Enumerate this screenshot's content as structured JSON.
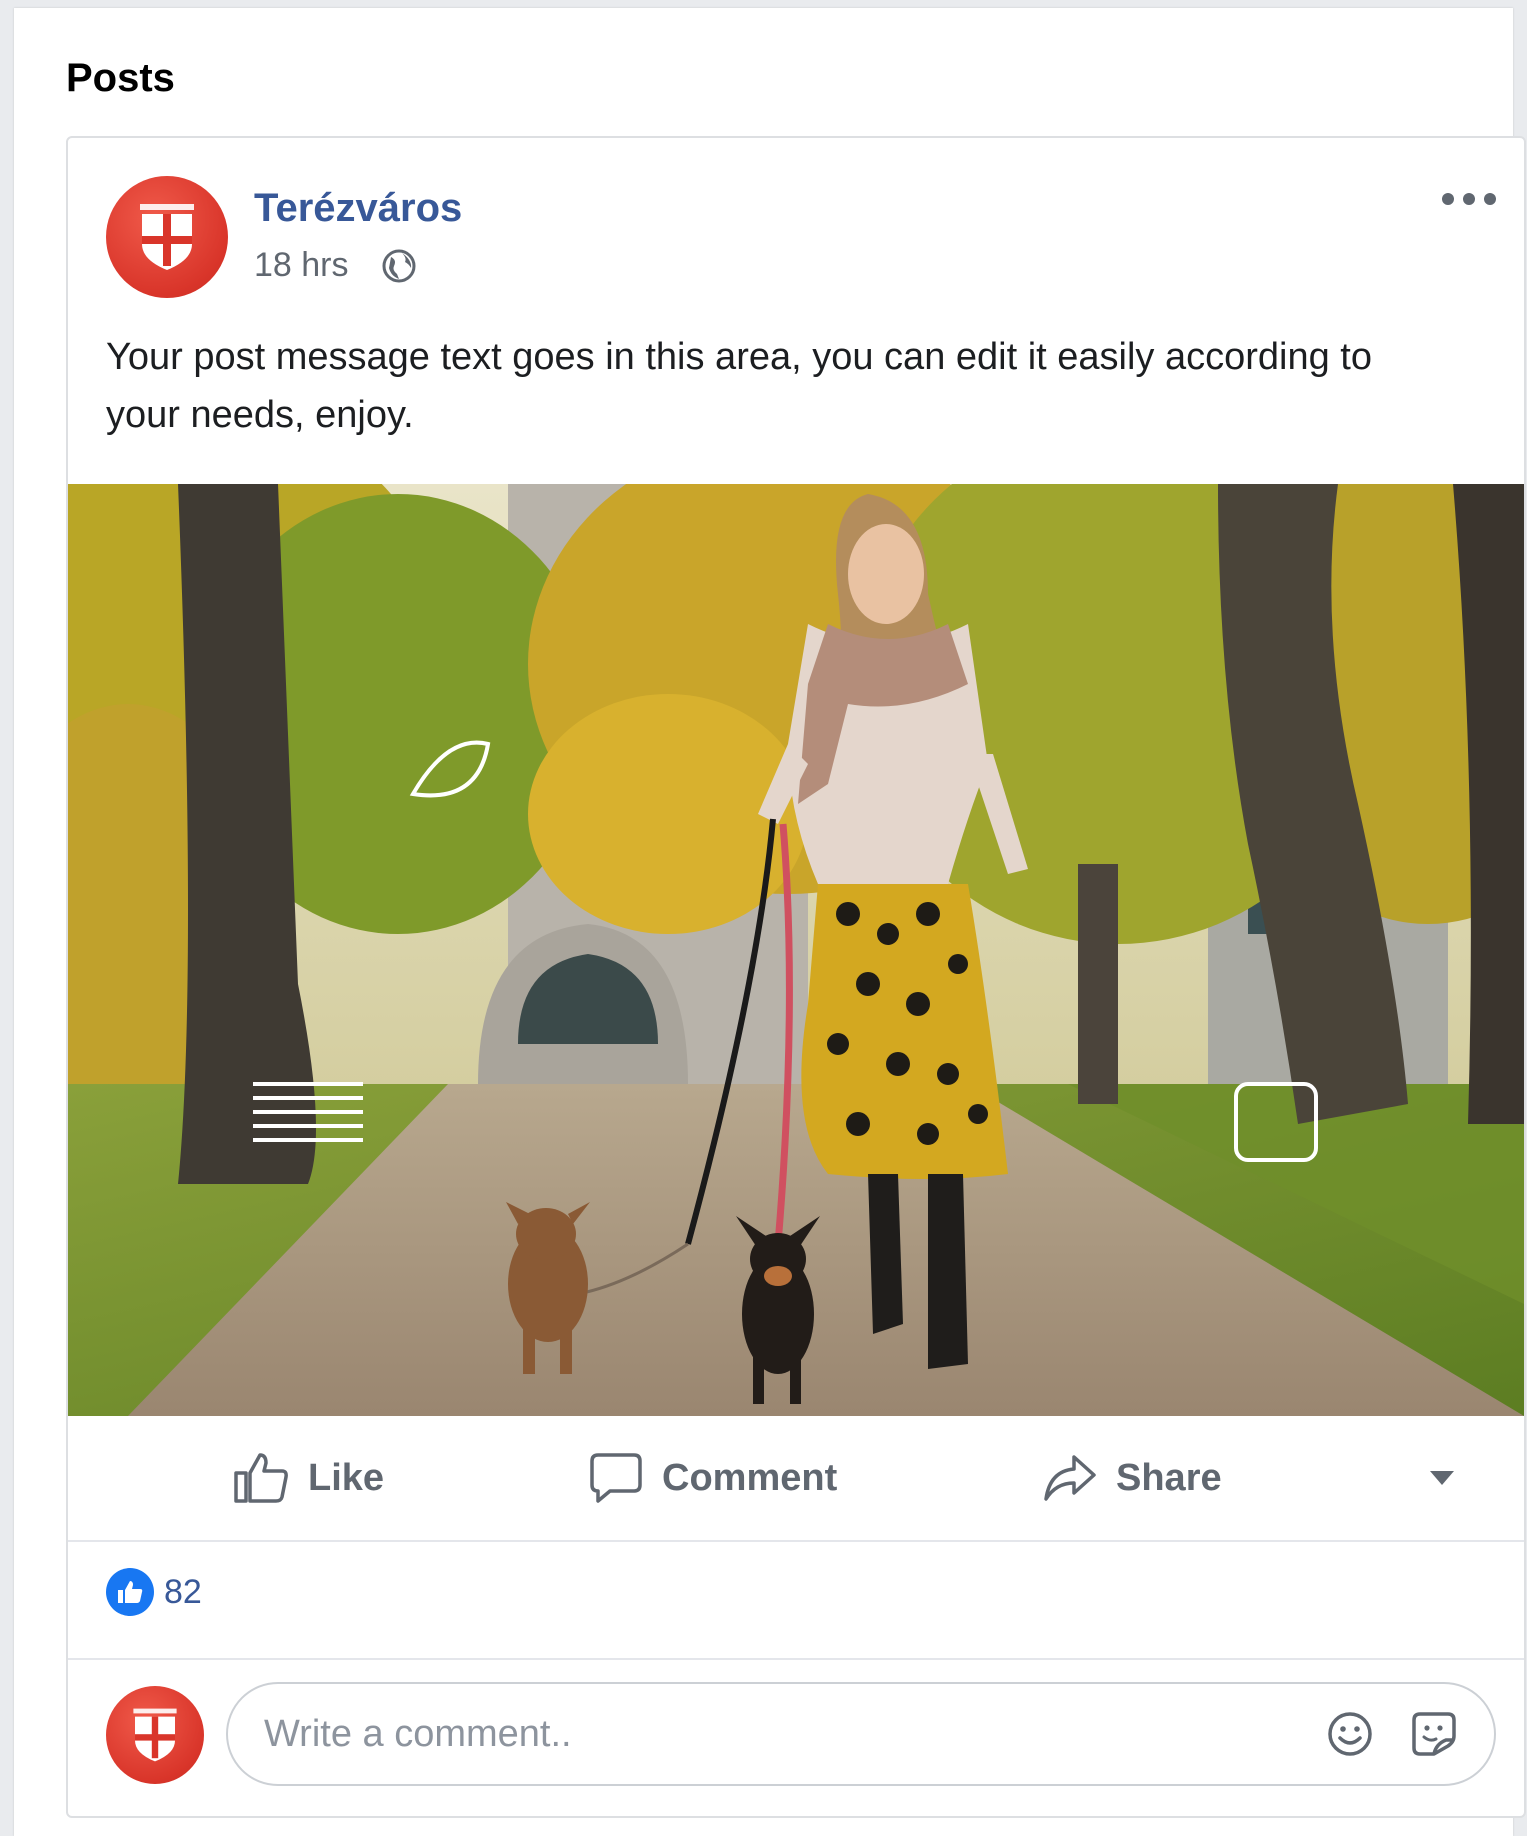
{
  "section": {
    "title": "Posts"
  },
  "post": {
    "author": "Terézváros",
    "time": "18 hrs",
    "privacy_icon": "globe-icon",
    "message": "Your post message text goes in this area, you can edit it easily according to your needs, enjoy.",
    "more_icon": "more-options-icon"
  },
  "actions": {
    "like": "Like",
    "comment": "Comment",
    "share": "Share"
  },
  "reactions": {
    "count": "82",
    "icon": "like-reaction-icon"
  },
  "comment": {
    "placeholder": "Write a comment.."
  },
  "colors": {
    "brand_red": "#d9352a",
    "link_blue": "#385898",
    "reaction_blue": "#1877f2",
    "muted": "#606770"
  }
}
